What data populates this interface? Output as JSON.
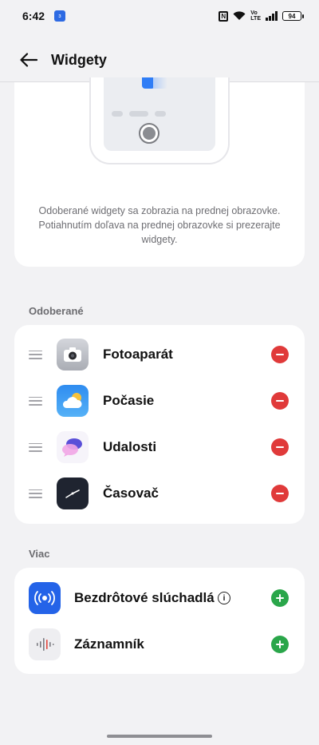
{
  "status": {
    "time": "6:42",
    "app_icon_text": "ɜ",
    "battery": "94"
  },
  "header": {
    "title": "Widgety"
  },
  "preview": {
    "description": "Odoberané widgety sa zobrazia na prednej obrazovke. Potiahnutím doľava na prednej obrazovke si prezerajte widgety."
  },
  "subscribed": {
    "section_label": "Odoberané",
    "items": [
      {
        "label": "Fotoaparát",
        "icon": "camera-icon"
      },
      {
        "label": "Počasie",
        "icon": "weather-icon"
      },
      {
        "label": "Udalosti",
        "icon": "events-icon"
      },
      {
        "label": "Časovač",
        "icon": "clock-icon"
      }
    ]
  },
  "more": {
    "section_label": "Viac",
    "items": [
      {
        "label": "Bezdrôtové slúchadlá",
        "icon": "wireless-earbuds-icon",
        "has_info": true
      },
      {
        "label": "Záznamník",
        "icon": "recorder-icon",
        "has_info": false
      }
    ]
  },
  "colors": {
    "remove": "#e03a3a",
    "add": "#2aa64a",
    "accent": "#2f7df6"
  }
}
